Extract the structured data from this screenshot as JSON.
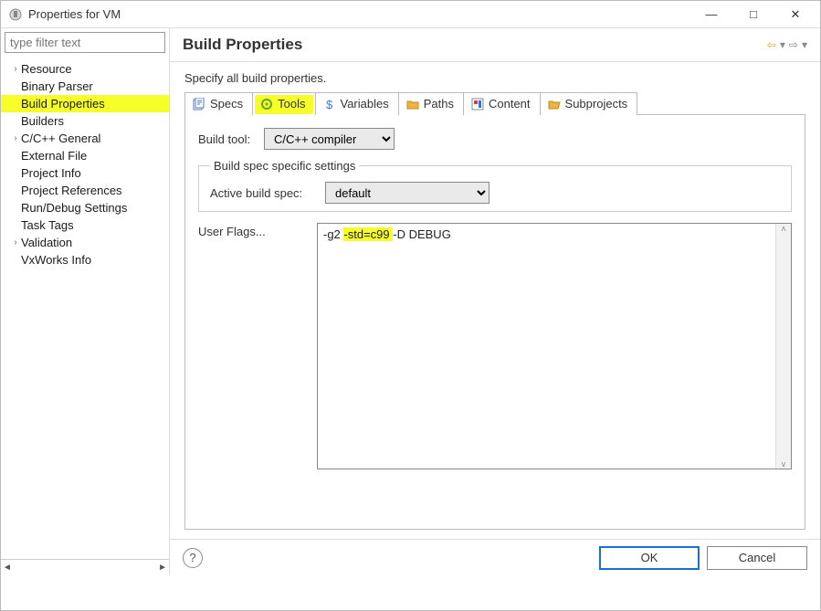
{
  "window": {
    "title": "Properties for VM",
    "minimize": "—",
    "maximize": "□",
    "close": "✕"
  },
  "filter": {
    "placeholder": "type filter text"
  },
  "tree": {
    "resource": "Resource",
    "binary_parser": "Binary Parser",
    "build_properties": "Build Properties",
    "builders": "Builders",
    "cpp_general": "C/C++ General",
    "external_file": "External File",
    "project_info": "Project Info",
    "project_refs": "Project References",
    "run_debug": "Run/Debug Settings",
    "task_tags": "Task Tags",
    "validation": "Validation",
    "vxworks_info": "VxWorks Info"
  },
  "header": {
    "title": "Build Properties"
  },
  "subtitle": "Specify all build properties.",
  "tabs": {
    "specs": "Specs",
    "tools": "Tools",
    "variables": "Variables",
    "paths": "Paths",
    "content": "Content",
    "subprojects": "Subprojects"
  },
  "panel": {
    "build_tool_label": "Build tool:",
    "build_tool_value": "C/C++ compiler",
    "fieldset_legend": "Build spec specific settings",
    "active_spec_label": "Active build spec:",
    "active_spec_value": "default",
    "user_flags_label": "User Flags...",
    "user_flags_pre": "-g2 ",
    "user_flags_hl": "-std=c99 ",
    "user_flags_post": "-D DEBUG"
  },
  "buttons": {
    "ok": "OK",
    "cancel": "Cancel"
  }
}
